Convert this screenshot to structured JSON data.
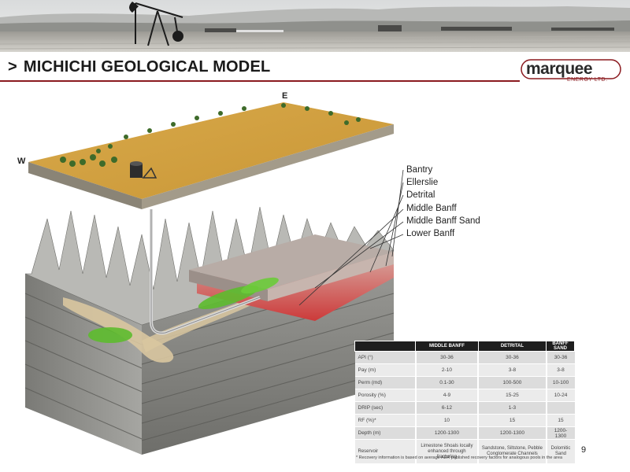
{
  "slide": {
    "chevron": ">",
    "title": "MICHICHI GEOLOGICAL MODEL",
    "page_number": "9"
  },
  "logo": {
    "name": "marquee",
    "sub": "ENERGY LTD."
  },
  "compass": {
    "west": "W",
    "east": "E"
  },
  "layers": [
    "Bantry",
    "Ellerslie",
    "Detrital",
    "Middle Banff",
    "Middle Banff Sand",
    "Lower Banff"
  ],
  "table": {
    "columns": [
      "",
      "MIDDLE BANFF",
      "DETRITAL",
      "BANFF SAND"
    ],
    "rows": [
      [
        "API (°)",
        "30-36",
        "30-36",
        "30-36"
      ],
      [
        "Pay (m)",
        "2-10",
        "3-8",
        "3-8"
      ],
      [
        "Perm (md)",
        "0.1-30",
        "100-500",
        "10-100"
      ],
      [
        "Porosity (%)",
        "4-9",
        "15-25",
        "10-24"
      ],
      [
        "DRIP (sec)",
        "6-12",
        "1-3",
        ""
      ],
      [
        "RF (%)*",
        "10",
        "15",
        "15"
      ],
      [
        "Depth (m)",
        "1200-1300",
        "1200-1300",
        "1200-1300"
      ],
      [
        "Reservoir",
        "Limestone Shoals locally enhanced through fracturing",
        "Sandstone, Siltstone, Pebble Conglomerate Channels",
        "Dolomitic Sand"
      ]
    ],
    "footnote": "* Recovery information is based on average AER published recovery factors for analogous pools in the area"
  },
  "colors": {
    "accent": "#8b1a1f",
    "table_header": "#1e1e1e"
  }
}
